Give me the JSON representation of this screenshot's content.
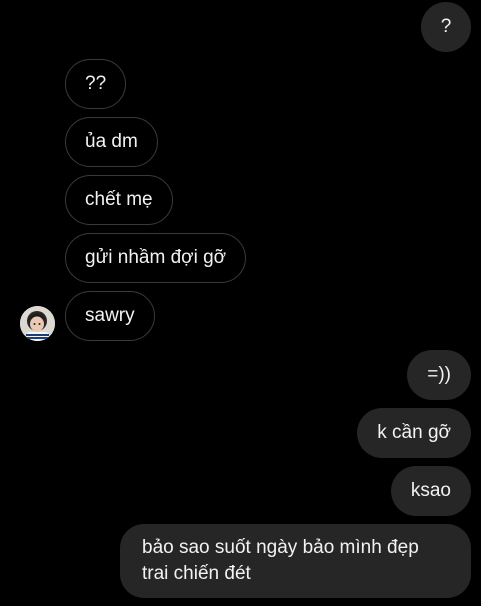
{
  "thread": {
    "messages": [
      {
        "side": "outgoing",
        "text": "?"
      },
      {
        "side": "incoming",
        "text": "??"
      },
      {
        "side": "incoming",
        "text": "ủa dm"
      },
      {
        "side": "incoming",
        "text": "chết mẹ"
      },
      {
        "side": "incoming",
        "text": "gửi nhầm đợi gỡ"
      },
      {
        "side": "incoming",
        "text": "sawry"
      },
      {
        "side": "outgoing",
        "text": "=))"
      },
      {
        "side": "outgoing",
        "text": "k cần gỡ"
      },
      {
        "side": "outgoing",
        "text": "ksao"
      },
      {
        "side": "outgoing",
        "text": "bảo sao suốt ngày bảo mình đẹp trai chiến đét"
      }
    ]
  },
  "colors": {
    "background": "#000000",
    "incoming_border": "#3a3a3a",
    "outgoing_fill": "#262626",
    "text": "#f2f2f2"
  },
  "icons": {
    "avatar": "contact-avatar-photo"
  }
}
